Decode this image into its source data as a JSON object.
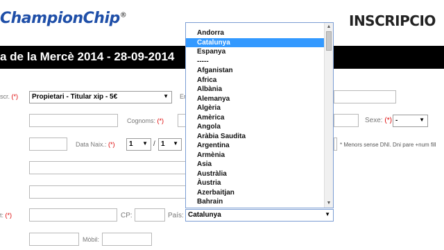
{
  "header": {
    "logo_text": "ChampionChip",
    "logo_mark": "®",
    "page_title": "INSCRIPCIO"
  },
  "event": {
    "title": "a de la Mercè 2014 - 28-09-2014"
  },
  "required_mark": "(*)",
  "form": {
    "inscr_label": "scr.",
    "inscr_type_value": "Propietari - Titular xip - 5€",
    "email_label": "Er",
    "surname_label": "Cognoms:",
    "sex_label": "Sexe:",
    "sex_value": "-",
    "birth_label": "Data Naix.:",
    "birth_day": "1",
    "birth_month": "1",
    "date_sep": "/",
    "dni_note": "* Menors sense DNI. Dni pare +num fill",
    "postal_code_label": "CP:",
    "country_label": "País:",
    "country_value": "Catalunya",
    "mobile_label": "Mòbil:"
  },
  "country_dropdown": {
    "selected": "Catalunya",
    "options": [
      "Andorra",
      "Catalunya",
      "Espanya",
      "-----",
      "Afganistan",
      "Africa",
      "Albània",
      "Alemanya",
      "Algèria",
      "Amèrica",
      "Angola",
      "Aràbia Saudita",
      "Argentina",
      "Armènia",
      "Asia",
      "Austràlia",
      "Àustria",
      "Azerbaitjan",
      "Bahrain"
    ]
  }
}
